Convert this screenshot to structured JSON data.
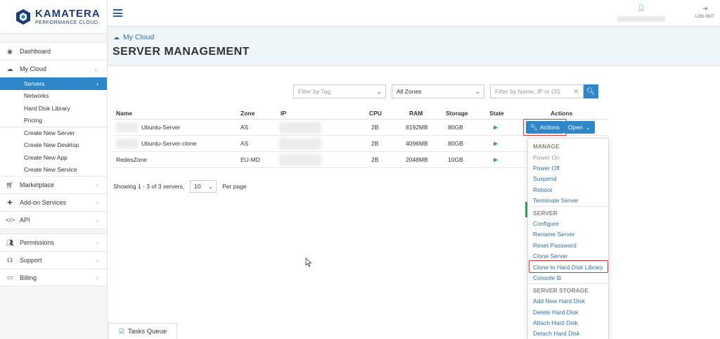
{
  "brand": {
    "name": "KAMATERA",
    "tagline": "PERFORMANCE CLOUD"
  },
  "sidebar": {
    "items": [
      {
        "label": "Dashboard",
        "icon": "dashboard-icon"
      },
      {
        "label": "My Cloud",
        "icon": "cloud-icon"
      }
    ],
    "mycloud_sub": [
      "Servers",
      "Networks",
      "Hard Disk Library",
      "Pricing"
    ],
    "mycloud_create": [
      "Create New Server",
      "Create New Desktop",
      "Create New App",
      "Create New Service"
    ],
    "items2": [
      {
        "label": "Marketplace",
        "icon": "cart-icon"
      },
      {
        "label": "Add-on Services",
        "icon": "puzzle-icon"
      },
      {
        "label": "API",
        "icon": "code-icon"
      }
    ],
    "items3": [
      {
        "label": "Permissions",
        "icon": "users-icon"
      },
      {
        "label": "Support",
        "icon": "headset-icon"
      },
      {
        "label": "Billing",
        "icon": "credit-card-icon"
      }
    ]
  },
  "topbar": {
    "logout": "LOG OUT"
  },
  "header": {
    "breadcrumb": "My Cloud",
    "title": "SERVER MANAGEMENT"
  },
  "filters": {
    "tag_placeholder": "Filter by Tag",
    "zone_value": "All Zones",
    "search_placeholder": "Filter by Name, IP or OS"
  },
  "table": {
    "headers": {
      "name": "Name",
      "zone": "Zone",
      "ip": "IP",
      "cpu": "CPU",
      "ram": "RAM",
      "storage": "Storage",
      "state": "State",
      "actions": "Actions"
    },
    "rows": [
      {
        "name": "Ubuntu-Server",
        "zone": "AS",
        "cpu": "2B",
        "ram": "8192MB",
        "storage": "80GB"
      },
      {
        "name": "Ubuntu-Server-clone",
        "zone": "AS",
        "cpu": "2B",
        "ram": "4096MB",
        "storage": "80GB"
      },
      {
        "name": "RedesZone",
        "zone": "EU-MD",
        "cpu": "2B",
        "ram": "2048MB",
        "storage": "10GB"
      }
    ],
    "actions_label": "Actions",
    "open_label": "Open"
  },
  "pagination": {
    "showing": "Showing 1 - 3 of 3 servers,",
    "page_size": "10",
    "per_page": "Per page"
  },
  "menu": {
    "manage_head": "MANAGE",
    "manage": [
      "Power On",
      "Power Off",
      "Suspend",
      "Reboot",
      "Terminate Server"
    ],
    "server_head": "SERVER",
    "server": [
      "Configure",
      "Rename Server",
      "Reset Password",
      "Clone Server",
      "Clone to Hard Disk Library",
      "Console"
    ],
    "storage_head": "SERVER STORAGE",
    "storage": [
      "Add New Hard Disk",
      "Delete Hard Disk",
      "Attach Hard Disk",
      "Detach Hard Disk"
    ]
  },
  "tasks": {
    "label": "Tasks Queue"
  },
  "colors": {
    "accent": "#2f86c8",
    "brand": "#1f3c7a",
    "highlight": "#e03030",
    "running": "#2fa84f"
  }
}
